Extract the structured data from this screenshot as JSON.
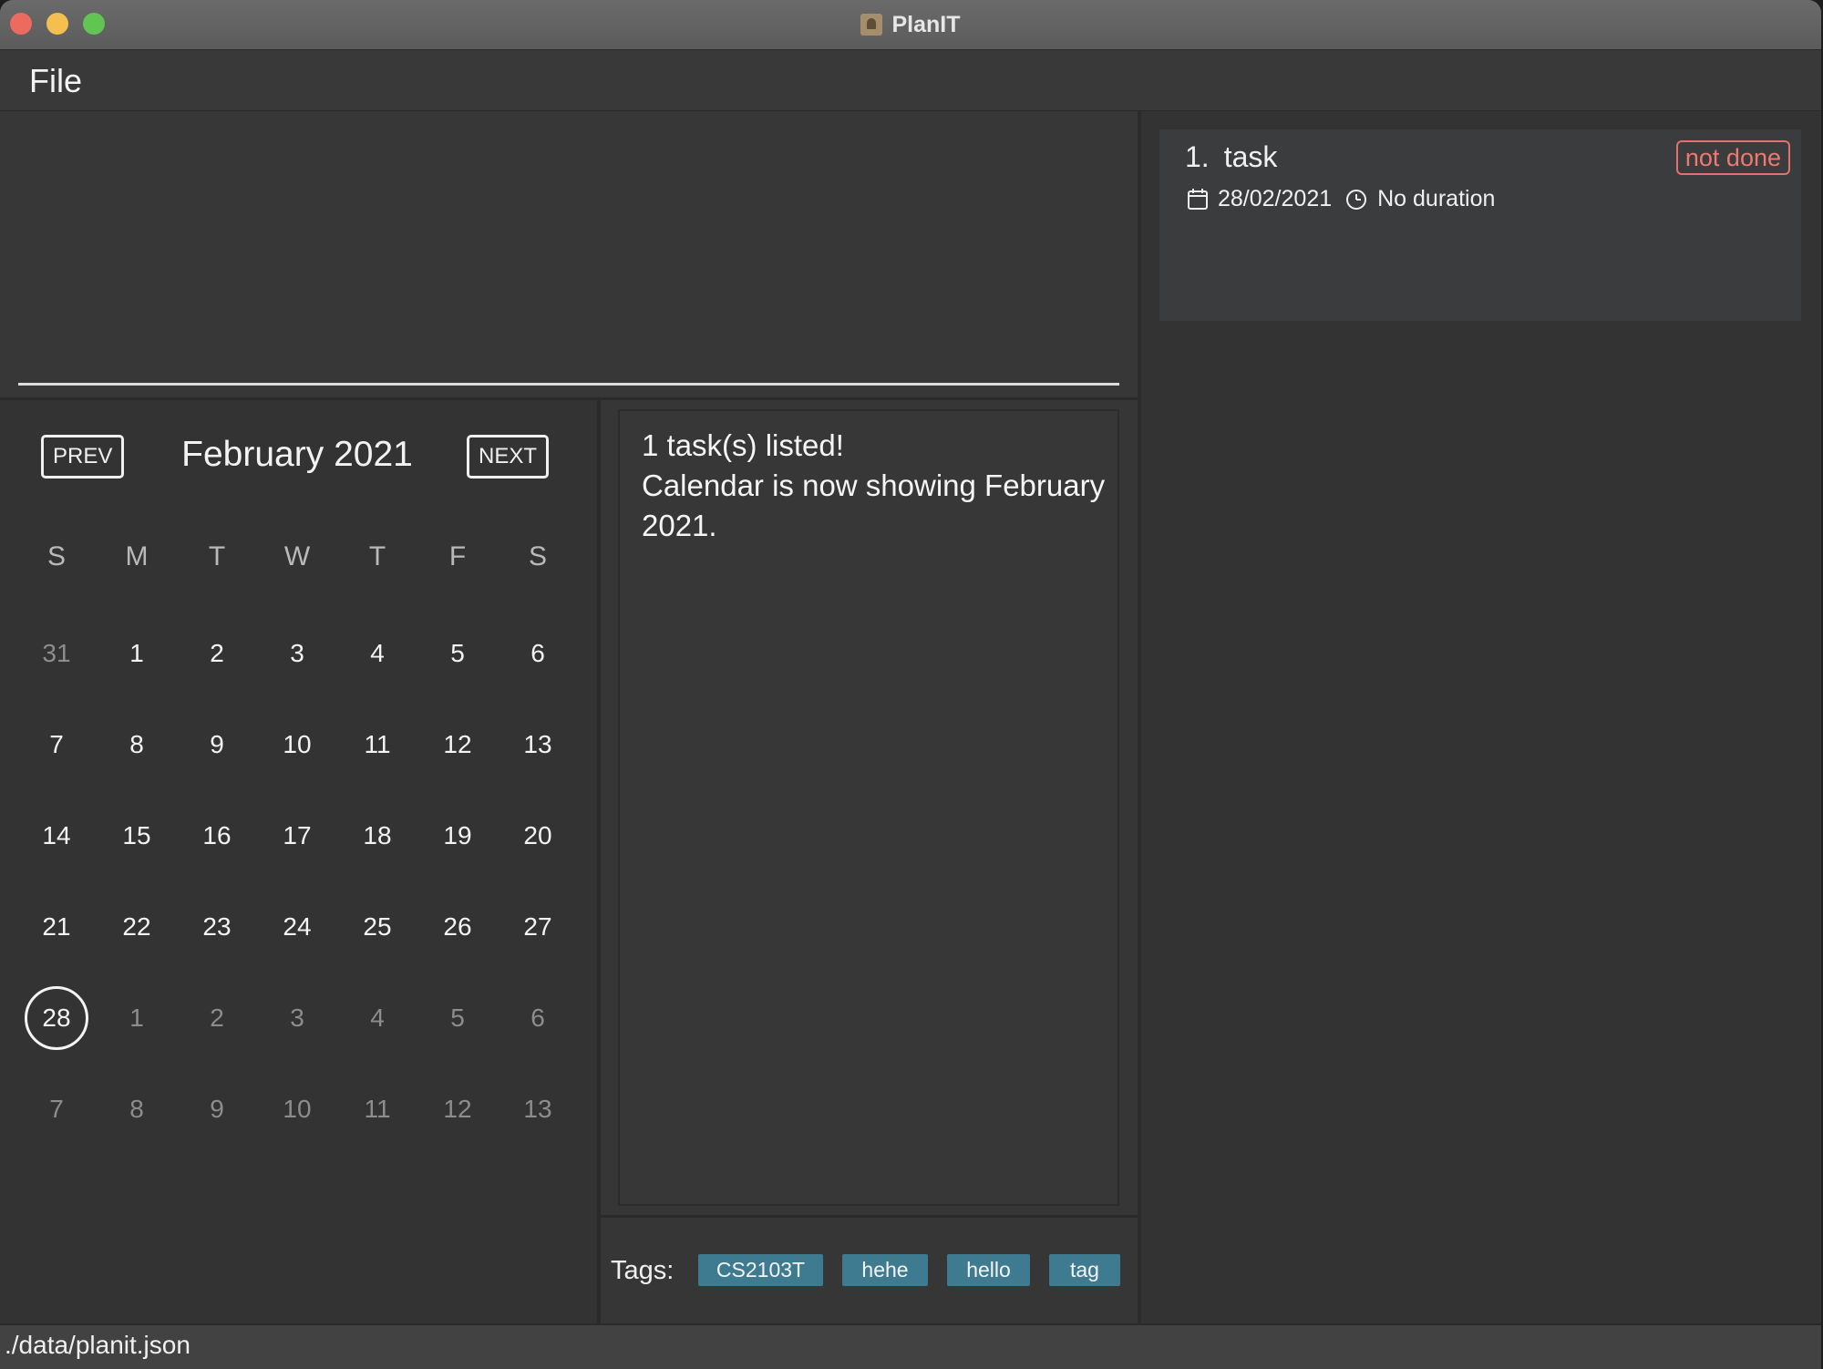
{
  "window": {
    "title": "PlanIT"
  },
  "menu": {
    "file_label": "File"
  },
  "calendar": {
    "prev_label": "PREV",
    "next_label": "NEXT",
    "month_title": "February 2021",
    "weekdays": [
      "S",
      "M",
      "T",
      "W",
      "T",
      "F",
      "S"
    ],
    "days": [
      {
        "label": "31",
        "muted": true
      },
      {
        "label": "1"
      },
      {
        "label": "2"
      },
      {
        "label": "3"
      },
      {
        "label": "4"
      },
      {
        "label": "5"
      },
      {
        "label": "6"
      },
      {
        "label": "7"
      },
      {
        "label": "8"
      },
      {
        "label": "9"
      },
      {
        "label": "10"
      },
      {
        "label": "11"
      },
      {
        "label": "12"
      },
      {
        "label": "13"
      },
      {
        "label": "14"
      },
      {
        "label": "15"
      },
      {
        "label": "16"
      },
      {
        "label": "17"
      },
      {
        "label": "18"
      },
      {
        "label": "19"
      },
      {
        "label": "20"
      },
      {
        "label": "21"
      },
      {
        "label": "22"
      },
      {
        "label": "23"
      },
      {
        "label": "24"
      },
      {
        "label": "25"
      },
      {
        "label": "26"
      },
      {
        "label": "27"
      },
      {
        "label": "28",
        "today": true
      },
      {
        "label": "1",
        "muted": true
      },
      {
        "label": "2",
        "muted": true
      },
      {
        "label": "3",
        "muted": true
      },
      {
        "label": "4",
        "muted": true
      },
      {
        "label": "5",
        "muted": true
      },
      {
        "label": "6",
        "muted": true
      },
      {
        "label": "7",
        "muted": true
      },
      {
        "label": "8",
        "muted": true
      },
      {
        "label": "9",
        "muted": true
      },
      {
        "label": "10",
        "muted": true
      },
      {
        "label": "11",
        "muted": true
      },
      {
        "label": "12",
        "muted": true
      },
      {
        "label": "13",
        "muted": true
      }
    ]
  },
  "feedback": {
    "line1": "1 task(s) listed!",
    "line2": "Calendar is now showing February 2021."
  },
  "tags": {
    "label": "Tags:",
    "items": [
      "CS2103T",
      "hehe",
      "hello",
      "tag"
    ]
  },
  "task": {
    "index": "1.",
    "title": "task",
    "status": "not done",
    "date": "28/02/2021",
    "duration": "No duration",
    "date_icon": "calendar-icon",
    "duration_icon": "clock-icon"
  },
  "status_bar": {
    "path": "./data/planit.json"
  },
  "colors": {
    "window_bg": "#363636",
    "status_red": "#ec7a70",
    "tag_bg": "#3e7b91"
  }
}
